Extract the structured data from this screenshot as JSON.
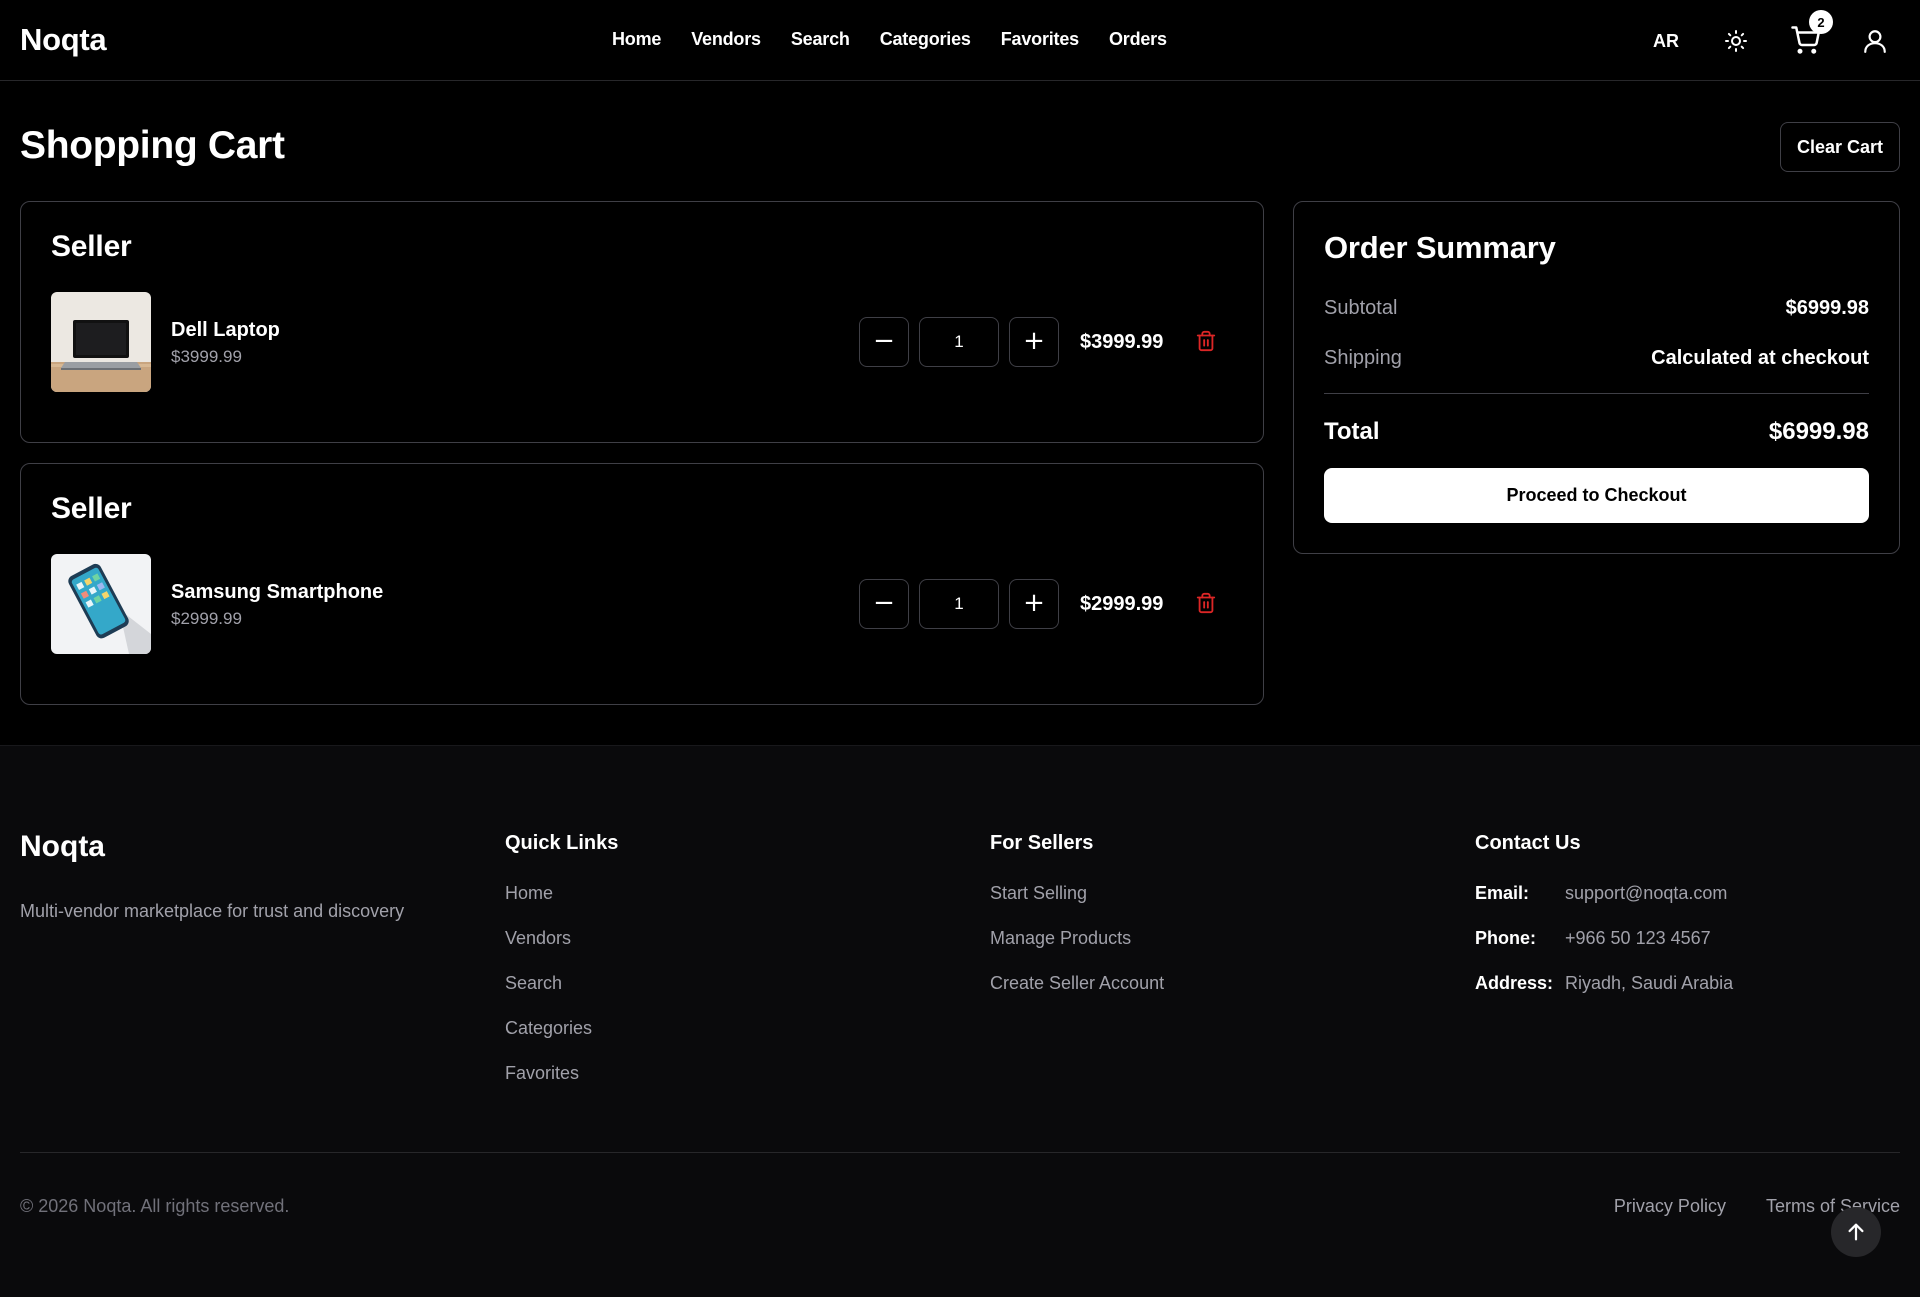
{
  "header": {
    "logo": "Noqta",
    "nav": [
      "Home",
      "Vendors",
      "Search",
      "Categories",
      "Favorites",
      "Orders"
    ],
    "lang": "AR",
    "cart_count": "2",
    "theme_icon": "sun-icon",
    "cart_icon": "cart-icon",
    "user_icon": "user-icon"
  },
  "page": {
    "title": "Shopping Cart",
    "clear_label": "Clear Cart"
  },
  "cart": [
    {
      "seller": "Seller",
      "name": "Dell Laptop",
      "price": "$3999.99",
      "quantity": "1",
      "line_total": "$3999.99",
      "decrease": "−",
      "increase": "+"
    },
    {
      "seller": "Seller",
      "name": "Samsung Smartphone",
      "price": "$2999.99",
      "quantity": "1",
      "line_total": "$2999.99",
      "decrease": "−",
      "increase": "+"
    }
  ],
  "summary": {
    "title": "Order Summary",
    "subtotal_label": "Subtotal",
    "subtotal_value": "$6999.98",
    "shipping_label": "Shipping",
    "shipping_value": "Calculated at checkout",
    "total_label": "Total",
    "total_value": "$6999.98",
    "checkout_label": "Proceed to Checkout"
  },
  "footer": {
    "logo": "Noqta",
    "tagline": "Multi-vendor marketplace for trust and discovery",
    "quick_links": {
      "title": "Quick Links",
      "items": [
        "Home",
        "Vendors",
        "Search",
        "Categories",
        "Favorites"
      ]
    },
    "for_sellers": {
      "title": "For Sellers",
      "items": [
        "Start Selling",
        "Manage Products",
        "Create Seller Account"
      ]
    },
    "contact": {
      "title": "Contact Us",
      "email_label": "Email:",
      "email": "support@noqta.com",
      "phone_label": "Phone:",
      "phone": "+966 50 123 4567",
      "address_label": "Address:",
      "address": "Riyadh, Saudi Arabia"
    },
    "copyright": "© 2026 Noqta. All rights reserved.",
    "privacy": "Privacy Policy",
    "terms": "Terms of Service"
  },
  "colors": {
    "background": "#000000",
    "footer_bg": "#0a0a0c",
    "border": "#3f3f46",
    "muted_text": "#a1a1aa",
    "danger": "#dc2626"
  }
}
